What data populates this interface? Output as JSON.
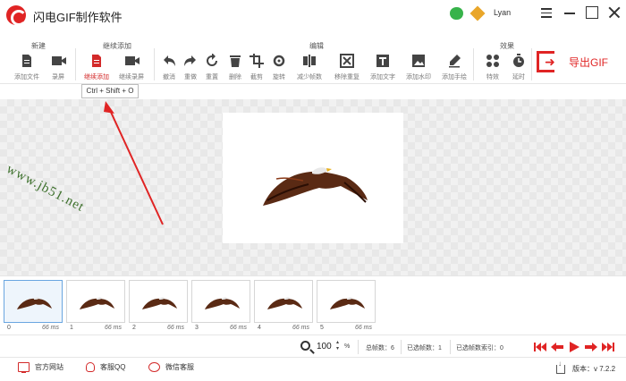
{
  "app": {
    "title": "闪电GIF制作软件",
    "username": "Lyan",
    "icons": [
      "app-logo-icon",
      "wechat-icon",
      "vip-icon",
      "menu-icon",
      "minimize-icon",
      "maximize-icon",
      "close-icon"
    ]
  },
  "toolbar": {
    "groups": {
      "new": "新建",
      "continue_add": "继续添加",
      "edit": "编辑",
      "effects": "效果"
    },
    "buttons": {
      "add_file": "添加文件",
      "record_screen": "录屏",
      "continue_add": "继续添加",
      "continue_record": "继续录屏",
      "undo": "撤消",
      "redo": "重做",
      "reset": "重置",
      "delete": "删除",
      "crop": "截剪",
      "rotate": "旋转",
      "reduce_frames": "减少帧数",
      "remove_duplicates": "移除重复",
      "add_text": "添加文字",
      "add_watermark": "添加水印",
      "add_handwriting": "添加手绘",
      "special_effects": "特效",
      "delay": "延时"
    },
    "export_label": "导出GIF",
    "tooltip": "Ctrl + Shift + O",
    "active_button": "continue_add"
  },
  "canvas": {
    "watermark": "www.jb51.net"
  },
  "frames": [
    {
      "index": "0",
      "duration": "66 ms",
      "selected": true
    },
    {
      "index": "1",
      "duration": "66 ms",
      "selected": false
    },
    {
      "index": "2",
      "duration": "66 ms",
      "selected": false
    },
    {
      "index": "3",
      "duration": "66 ms",
      "selected": false
    },
    {
      "index": "4",
      "duration": "66 ms",
      "selected": false
    },
    {
      "index": "5",
      "duration": "66 ms",
      "selected": false
    }
  ],
  "status": {
    "zoom_value": "100",
    "zoom_unit": "%",
    "total_frames": "总帧数：6",
    "selected_frames": "已选帧数：1",
    "selected_index": "已选帧数索引：0"
  },
  "footer": {
    "official_site": "官方网站",
    "qq_support": "客服QQ",
    "wechat_support": "微信客服",
    "version": "版本：v 7.2.2"
  },
  "colors": {
    "accent": "#e02424",
    "selected_frame_border": "#6aa6e0",
    "canvas_bg": "#f1f1f1"
  }
}
